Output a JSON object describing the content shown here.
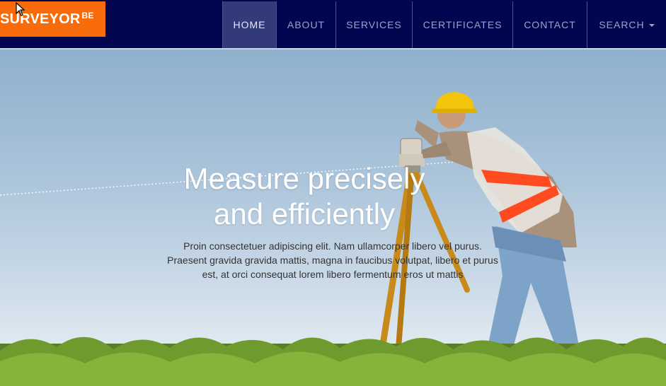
{
  "brand": {
    "name": "SURVEYOR",
    "suffix": "BE"
  },
  "nav": {
    "items": [
      {
        "label": "HOME",
        "active": true
      },
      {
        "label": "ABOUT"
      },
      {
        "label": "SERVICES"
      },
      {
        "label": "CERTIFICATES"
      },
      {
        "label": "CONTACT"
      },
      {
        "label": "SEARCH",
        "dropdown": true
      }
    ]
  },
  "hero": {
    "headline_line1": "Measure precisely",
    "headline_line2": "and efficiently",
    "lead_line1": "Proin consectetuer adipiscing elit. Nam ullamcorper libero vel purus.",
    "lead_line2": "Praesent gravida gravida mattis, magna in faucibus volutpat, libero et purus",
    "lead_line3": "est, at orci consequat lorem libero fermentum eros ut mattis"
  },
  "colors": {
    "nav_bg": "#020550",
    "brand_bg": "#f76b0a",
    "nav_active": "#323a7a"
  }
}
